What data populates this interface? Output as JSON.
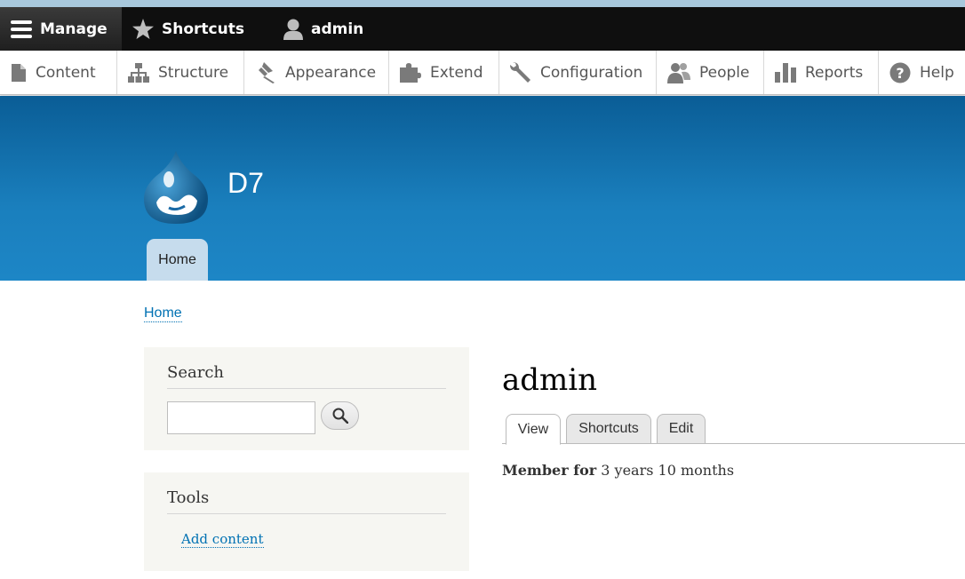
{
  "toolbar": {
    "manage_label": "Manage",
    "shortcuts_label": "Shortcuts",
    "user_label": "admin"
  },
  "tray": {
    "items": [
      {
        "label": "Content",
        "icon": "file-icon"
      },
      {
        "label": "Structure",
        "icon": "sitemap-icon"
      },
      {
        "label": "Appearance",
        "icon": "paintbrush-icon"
      },
      {
        "label": "Extend",
        "icon": "puzzle-icon"
      },
      {
        "label": "Configuration",
        "icon": "wrench-icon"
      },
      {
        "label": "People",
        "icon": "people-icon"
      },
      {
        "label": "Reports",
        "icon": "bar-chart-icon"
      },
      {
        "label": "Help",
        "icon": "help-icon"
      }
    ]
  },
  "header": {
    "site_name": "D7",
    "home_tab": "Home"
  },
  "breadcrumb": {
    "home": "Home"
  },
  "sidebar": {
    "search_title": "Search",
    "search_value": "",
    "tools_title": "Tools",
    "tools_link": "Add content"
  },
  "main": {
    "title": "admin",
    "tabs": [
      {
        "label": "View"
      },
      {
        "label": "Shortcuts"
      },
      {
        "label": "Edit"
      }
    ],
    "member_label": "Member for",
    "member_value": "3 years 10 months"
  },
  "colors": {
    "header_top": "#0a5d96",
    "header_bottom": "#1d86c6",
    "link": "#0071b3",
    "toolbar": "#0f0f0f"
  }
}
